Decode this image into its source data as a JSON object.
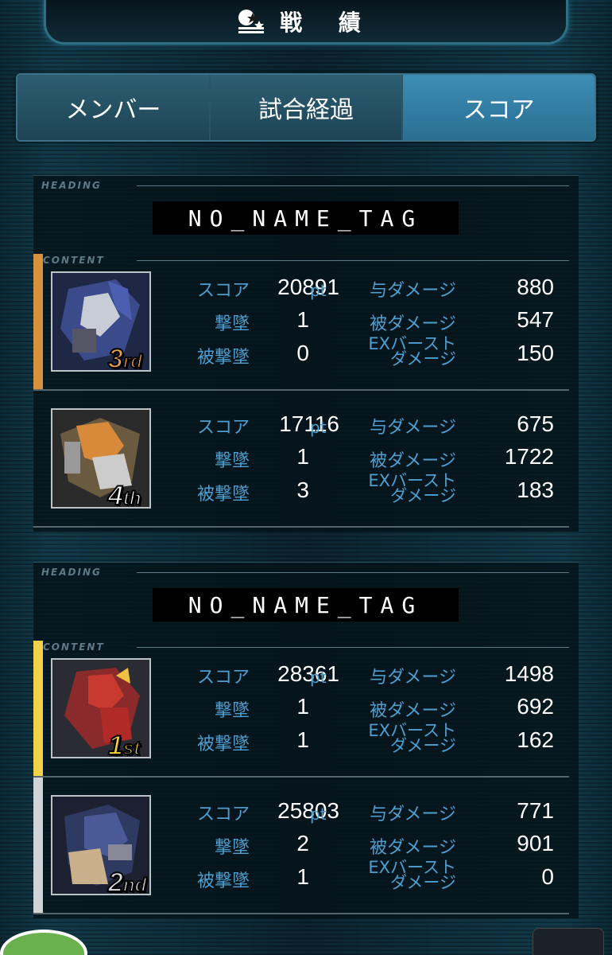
{
  "header": {
    "title": "戦 績",
    "icon": "results-emblem-icon"
  },
  "tabs": [
    {
      "label": "メンバー",
      "active": false
    },
    {
      "label": "試合経過",
      "active": false
    },
    {
      "label": "スコア",
      "active": true
    }
  ],
  "labels": {
    "heading": "HEADING",
    "content": "CONTENT",
    "score": "スコア",
    "kills": "撃墜",
    "deaths": "被撃墜",
    "damage_dealt": "与ダメージ",
    "damage_taken": "被ダメージ",
    "ex_burst_line1": "EXバースト",
    "ex_burst_line2": "ダメージ",
    "pt_unit": "pt"
  },
  "teams": [
    {
      "tag": "NO_NAME_TAG",
      "players": [
        {
          "rank_num": "3",
          "rank_sfx": "rd",
          "rank_color": "#e8a04a",
          "accent": "#d9913e",
          "portrait_color": "#3a4a8a",
          "portrait_icon": "blue-gundam-portrait",
          "score": "20891",
          "kills": "1",
          "deaths": "0",
          "damage_dealt": "880",
          "damage_taken": "547",
          "ex_burst": "150"
        },
        {
          "rank_num": "4",
          "rank_sfx": "th",
          "rank_color": "#ffffff",
          "accent": "transparent",
          "portrait_color": "#6a5a40",
          "portrait_icon": "orange-gundam-portrait",
          "score": "17116",
          "kills": "1",
          "deaths": "3",
          "damage_dealt": "675",
          "damage_taken": "1722",
          "ex_burst": "183"
        }
      ]
    },
    {
      "tag": "NO_NAME_TAG",
      "players": [
        {
          "rank_num": "1",
          "rank_sfx": "st",
          "rank_color": "#f5d040",
          "accent": "#f2d24a",
          "portrait_color": "#8a2a2a",
          "portrait_icon": "red-gundam-portrait",
          "score": "28361",
          "kills": "1",
          "deaths": "1",
          "damage_dealt": "1498",
          "damage_taken": "692",
          "ex_burst": "162"
        },
        {
          "rank_num": "2",
          "rank_sfx": "nd",
          "rank_color": "#d8dde0",
          "accent": "#d0d4d6",
          "portrait_color": "#2e3a62",
          "portrait_icon": "navy-gundam-portrait",
          "score": "25803",
          "kills": "2",
          "deaths": "1",
          "damage_dealt": "771",
          "damage_taken": "901",
          "ex_burst": "0"
        }
      ]
    }
  ]
}
